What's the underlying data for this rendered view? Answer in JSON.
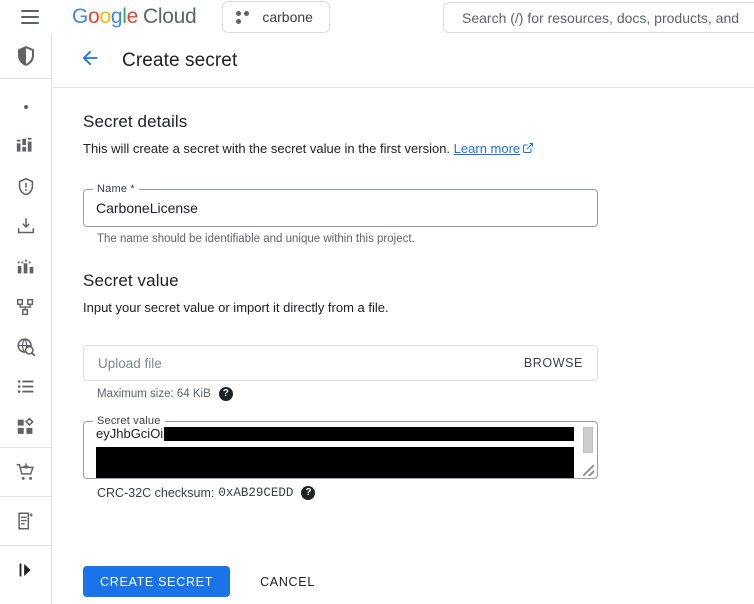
{
  "topbar": {
    "menu_icon": "hamburger-menu-icon",
    "logo_google": "Google",
    "logo_cloud": "Cloud",
    "project_name": "carbone",
    "project_icon": "project-dots-icon",
    "search_placeholder": "Search (/) for resources, docs, products, and"
  },
  "rail": {
    "items": [
      {
        "icon": "shield-icon",
        "name": "sidebar-item-security"
      },
      {
        "icon": "dot-icon",
        "name": "sidebar-item-dot"
      },
      {
        "icon": "dashboard-icon",
        "name": "sidebar-item-dashboard"
      },
      {
        "icon": "shield-alert-icon",
        "name": "sidebar-item-risk"
      },
      {
        "icon": "download-icon",
        "name": "sidebar-item-import"
      },
      {
        "icon": "bar-chart-icon",
        "name": "sidebar-item-reports"
      },
      {
        "icon": "hierarchy-icon",
        "name": "sidebar-item-topology"
      },
      {
        "icon": "globe-search-icon",
        "name": "sidebar-item-discovery"
      },
      {
        "icon": "list-icon",
        "name": "sidebar-item-list"
      },
      {
        "icon": "apps-grid-icon",
        "name": "sidebar-item-products"
      },
      {
        "icon": "marketplace-cart-icon",
        "name": "sidebar-item-marketplace"
      },
      {
        "icon": "release-notes-icon",
        "name": "sidebar-item-release-notes"
      },
      {
        "icon": "expand-panel-icon",
        "name": "sidebar-item-expand"
      }
    ]
  },
  "page": {
    "back_icon": "back-arrow-icon",
    "title": "Create secret"
  },
  "secret_details": {
    "heading": "Secret details",
    "description": "This will create a secret with the secret value in the first version.",
    "learn_more": "Learn more",
    "learn_more_icon": "external-link-icon",
    "name_label": "Name *",
    "name_value": "CarboneLicense",
    "name_helper": "The name should be identifiable and unique within this project."
  },
  "secret_value": {
    "heading": "Secret value",
    "description": "Input your secret value or import it directly from a file.",
    "upload_placeholder": "Upload file",
    "browse_label": "BROWSE",
    "max_size_text": "Maximum size: 64 KiB",
    "max_size_help_icon": "help-icon",
    "textarea_label": "Secret value",
    "textarea_visible_text": "eyJhbGciOi",
    "textarea_redacted": true,
    "crc_label": "CRC-32C checksum:",
    "crc_value": "0xAB29CEDD",
    "crc_help_icon": "help-icon"
  },
  "footer": {
    "create_label": "CREATE SECRET",
    "cancel_label": "CANCEL"
  },
  "colors": {
    "accent_blue": "#1a73e8",
    "google_blue": "#4285f4",
    "google_red": "#ea4335",
    "google_yellow": "#fbbc05",
    "google_green": "#34a853",
    "text_primary": "#202124",
    "text_secondary": "#5f6368",
    "border": "#dadce0"
  }
}
